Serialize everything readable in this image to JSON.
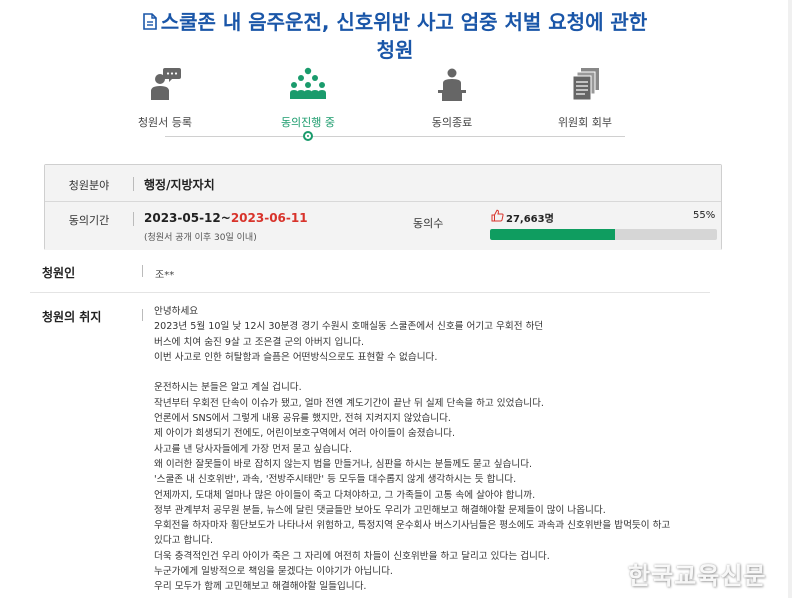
{
  "header": {
    "title_line1": "스쿨존 내 음주운전, 신호위반 사고 엄중 처벌 요청에 관한",
    "title_line2": "청원"
  },
  "steps": [
    {
      "label": "청원서 등록",
      "icon": "chat-person-icon",
      "active": false
    },
    {
      "label": "동의진행 중",
      "icon": "group-people-icon",
      "active": true
    },
    {
      "label": "동의종료",
      "icon": "podium-person-icon",
      "active": false
    },
    {
      "label": "위원회 회부",
      "icon": "documents-stack-icon",
      "active": false
    }
  ],
  "info": {
    "field_label": "청원분야",
    "field_value": "행정/지방자치",
    "period_label": "동의기간",
    "period_start": "2023-05-12~",
    "period_end": "2023-06-11",
    "period_note": "(청원서 공개 이후 30일 이내)",
    "count_label": "동의수",
    "count_value": "27,663명",
    "percent_text": "55%",
    "progress_fraction": 0.55,
    "progress_color": "#0f9d60"
  },
  "petitioner": {
    "label": "청원인",
    "value": "조**"
  },
  "purpose": {
    "label": "청원의 취지",
    "lines": [
      "안녕하세요",
      "2023년 5월 10일 낮 12시 30분경 경기 수원시 호매실동 스쿨존에서 신호를 어기고 우회전 하던",
      "버스에 치여 숨진 9살 고 조은결 군의 아버지 입니다.",
      "이번 사고로 인한 허탈함과 슬픔은 어떤방식으로도 표현할 수 없습니다.",
      "",
      "운전하시는 분들은 알고 계실 겁니다.",
      "작년부터 우회전 단속이 이슈가 됐고, 얼마 전엔 계도기간이 끝난 뒤 실제 단속을 하고 있었습니다.",
      "언론에서 SNS에서 그렇게 내용 공유를 했지만, 전혀 지켜지지 않았습니다.",
      "제 아이가 희생되기 전에도, 어린이보호구역에서 여러 아이들이 숨졌습니다.",
      "사고를 낸 당사자들에게 가장 먼저 묻고 싶습니다.",
      "왜 이러한 잘못들이 바로 잡히지 않는지 법을 만들거나, 심판을 하시는 분들께도 묻고 싶습니다.",
      "'스쿨존 내 신호위반', 과속, '전방주시태만' 등 모두들 대수롭지 않게 생각하시는 듯 합니다.",
      "언제까지, 도대체 얼마나 많은 아이들이 죽고 다쳐야하고, 그 가족들이 고통 속에 살아야 합니까.",
      "정부 관계부처 공무원 분들, 뉴스에 달린 댓글들만 보아도 우리가 고민해보고 해결해야할 문제들이 많이 나옵니다.",
      "우회전을 하자마자 횡단보도가 나타나서 위험하고, 특정지역 운수회사 버스기사님들은 평소에도 과속과 신호위반을 밥먹듯이 하고",
      "있다고 합니다.",
      "더욱 충격적인건 우리 아이가 죽은 그 자리에 여전히 차들이 신호위반을 하고 달리고 있다는 겁니다.",
      "누군가에게 일방적으로 책임을 묻겠다는 이야기가 아닙니다.",
      "우리 모두가 함께 고민해보고 해결해야할 일들입니다."
    ]
  },
  "watermark": "한국교육신문",
  "colors": {
    "title": "#1a56a8",
    "active_step": "#1a9b6c",
    "end_date": "#d8332b"
  }
}
